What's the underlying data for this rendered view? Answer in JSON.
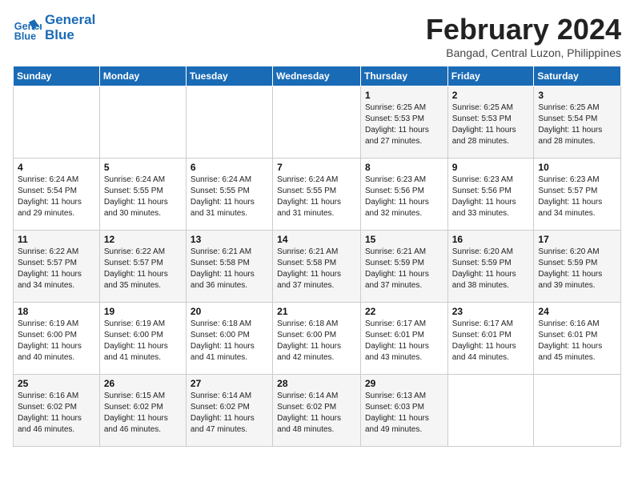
{
  "header": {
    "logo_line1": "General",
    "logo_line2": "Blue",
    "month": "February 2024",
    "location": "Bangad, Central Luzon, Philippines"
  },
  "weekdays": [
    "Sunday",
    "Monday",
    "Tuesday",
    "Wednesday",
    "Thursday",
    "Friday",
    "Saturday"
  ],
  "weeks": [
    [
      {
        "day": "",
        "info": ""
      },
      {
        "day": "",
        "info": ""
      },
      {
        "day": "",
        "info": ""
      },
      {
        "day": "",
        "info": ""
      },
      {
        "day": "1",
        "info": "Sunrise: 6:25 AM\nSunset: 5:53 PM\nDaylight: 11 hours\nand 27 minutes."
      },
      {
        "day": "2",
        "info": "Sunrise: 6:25 AM\nSunset: 5:53 PM\nDaylight: 11 hours\nand 28 minutes."
      },
      {
        "day": "3",
        "info": "Sunrise: 6:25 AM\nSunset: 5:54 PM\nDaylight: 11 hours\nand 28 minutes."
      }
    ],
    [
      {
        "day": "4",
        "info": "Sunrise: 6:24 AM\nSunset: 5:54 PM\nDaylight: 11 hours\nand 29 minutes."
      },
      {
        "day": "5",
        "info": "Sunrise: 6:24 AM\nSunset: 5:55 PM\nDaylight: 11 hours\nand 30 minutes."
      },
      {
        "day": "6",
        "info": "Sunrise: 6:24 AM\nSunset: 5:55 PM\nDaylight: 11 hours\nand 31 minutes."
      },
      {
        "day": "7",
        "info": "Sunrise: 6:24 AM\nSunset: 5:55 PM\nDaylight: 11 hours\nand 31 minutes."
      },
      {
        "day": "8",
        "info": "Sunrise: 6:23 AM\nSunset: 5:56 PM\nDaylight: 11 hours\nand 32 minutes."
      },
      {
        "day": "9",
        "info": "Sunrise: 6:23 AM\nSunset: 5:56 PM\nDaylight: 11 hours\nand 33 minutes."
      },
      {
        "day": "10",
        "info": "Sunrise: 6:23 AM\nSunset: 5:57 PM\nDaylight: 11 hours\nand 34 minutes."
      }
    ],
    [
      {
        "day": "11",
        "info": "Sunrise: 6:22 AM\nSunset: 5:57 PM\nDaylight: 11 hours\nand 34 minutes."
      },
      {
        "day": "12",
        "info": "Sunrise: 6:22 AM\nSunset: 5:57 PM\nDaylight: 11 hours\nand 35 minutes."
      },
      {
        "day": "13",
        "info": "Sunrise: 6:21 AM\nSunset: 5:58 PM\nDaylight: 11 hours\nand 36 minutes."
      },
      {
        "day": "14",
        "info": "Sunrise: 6:21 AM\nSunset: 5:58 PM\nDaylight: 11 hours\nand 37 minutes."
      },
      {
        "day": "15",
        "info": "Sunrise: 6:21 AM\nSunset: 5:59 PM\nDaylight: 11 hours\nand 37 minutes."
      },
      {
        "day": "16",
        "info": "Sunrise: 6:20 AM\nSunset: 5:59 PM\nDaylight: 11 hours\nand 38 minutes."
      },
      {
        "day": "17",
        "info": "Sunrise: 6:20 AM\nSunset: 5:59 PM\nDaylight: 11 hours\nand 39 minutes."
      }
    ],
    [
      {
        "day": "18",
        "info": "Sunrise: 6:19 AM\nSunset: 6:00 PM\nDaylight: 11 hours\nand 40 minutes."
      },
      {
        "day": "19",
        "info": "Sunrise: 6:19 AM\nSunset: 6:00 PM\nDaylight: 11 hours\nand 41 minutes."
      },
      {
        "day": "20",
        "info": "Sunrise: 6:18 AM\nSunset: 6:00 PM\nDaylight: 11 hours\nand 41 minutes."
      },
      {
        "day": "21",
        "info": "Sunrise: 6:18 AM\nSunset: 6:00 PM\nDaylight: 11 hours\nand 42 minutes."
      },
      {
        "day": "22",
        "info": "Sunrise: 6:17 AM\nSunset: 6:01 PM\nDaylight: 11 hours\nand 43 minutes."
      },
      {
        "day": "23",
        "info": "Sunrise: 6:17 AM\nSunset: 6:01 PM\nDaylight: 11 hours\nand 44 minutes."
      },
      {
        "day": "24",
        "info": "Sunrise: 6:16 AM\nSunset: 6:01 PM\nDaylight: 11 hours\nand 45 minutes."
      }
    ],
    [
      {
        "day": "25",
        "info": "Sunrise: 6:16 AM\nSunset: 6:02 PM\nDaylight: 11 hours\nand 46 minutes."
      },
      {
        "day": "26",
        "info": "Sunrise: 6:15 AM\nSunset: 6:02 PM\nDaylight: 11 hours\nand 46 minutes."
      },
      {
        "day": "27",
        "info": "Sunrise: 6:14 AM\nSunset: 6:02 PM\nDaylight: 11 hours\nand 47 minutes."
      },
      {
        "day": "28",
        "info": "Sunrise: 6:14 AM\nSunset: 6:02 PM\nDaylight: 11 hours\nand 48 minutes."
      },
      {
        "day": "29",
        "info": "Sunrise: 6:13 AM\nSunset: 6:03 PM\nDaylight: 11 hours\nand 49 minutes."
      },
      {
        "day": "",
        "info": ""
      },
      {
        "day": "",
        "info": ""
      }
    ]
  ]
}
